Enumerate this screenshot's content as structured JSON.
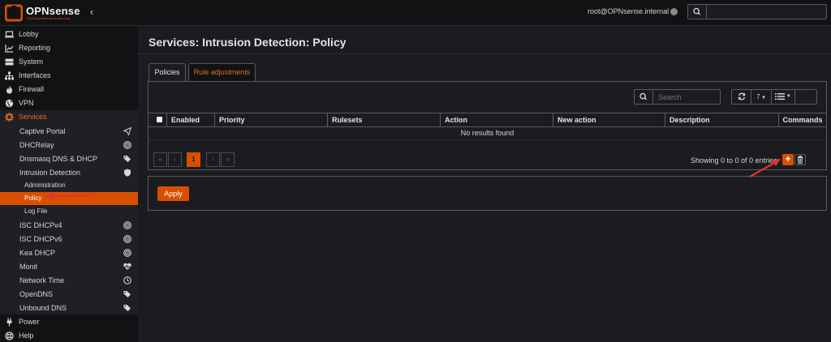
{
  "header": {
    "brand": "OPNsense",
    "tagline": "Securing networks made easy",
    "user": "root@OPNsense.internal",
    "search_placeholder": ""
  },
  "sidebar": {
    "items": [
      {
        "label": "Lobby",
        "icon": "laptop-icon"
      },
      {
        "label": "Reporting",
        "icon": "chart-icon"
      },
      {
        "label": "System",
        "icon": "server-icon"
      },
      {
        "label": "Interfaces",
        "icon": "sitemap-icon"
      },
      {
        "label": "Firewall",
        "icon": "fire-icon"
      },
      {
        "label": "VPN",
        "icon": "globe-icon"
      },
      {
        "label": "Services",
        "icon": "gear-icon"
      }
    ],
    "services_children": [
      {
        "label": "Captive Portal",
        "icon": "send-icon"
      },
      {
        "label": "DHCRelay",
        "icon": "bullseye-icon"
      },
      {
        "label": "Dnsmasq DNS & DHCP",
        "icon": "tags-icon"
      },
      {
        "label": "Intrusion Detection",
        "icon": "shield-icon"
      }
    ],
    "ids_children": [
      {
        "label": "Administration"
      },
      {
        "label": "Policy"
      },
      {
        "label": "Log File"
      }
    ],
    "services_children_after": [
      {
        "label": "ISC DHCPv4",
        "icon": "bullseye-icon"
      },
      {
        "label": "ISC DHCPv6",
        "icon": "bullseye-icon"
      },
      {
        "label": "Kea DHCP",
        "icon": "bullseye-icon"
      },
      {
        "label": "Monit",
        "icon": "heartbeat-icon"
      },
      {
        "label": "Network Time",
        "icon": "clock-icon"
      },
      {
        "label": "OpenDNS",
        "icon": "tags-icon"
      },
      {
        "label": "Unbound DNS",
        "icon": "tags-icon"
      }
    ],
    "bottom_items": [
      {
        "label": "Power",
        "icon": "plug-icon"
      },
      {
        "label": "Help",
        "icon": "lifebuoy-icon"
      }
    ]
  },
  "main": {
    "title": "Services: Intrusion Detection: Policy",
    "tabs": [
      {
        "label": "Policies",
        "active": true
      },
      {
        "label": "Rule adjustments",
        "active": false
      }
    ],
    "toolbar": {
      "search_placeholder": "Search",
      "page_size": "7"
    },
    "table": {
      "columns": [
        "Enabled",
        "Priority",
        "Rulesets",
        "Action",
        "New action",
        "Description",
        "Commands"
      ],
      "empty_message": "No results found"
    },
    "pagination": {
      "first": "«",
      "prev": "‹",
      "current": "1",
      "next": "›",
      "last": "»"
    },
    "showing": "Showing 0 to 0 of 0 entries",
    "apply_label": "Apply"
  },
  "colors": {
    "accent": "#d94f00",
    "background": "#1b1c20",
    "sidebar": "#111214",
    "annotation_arrow": "#e8322a"
  }
}
